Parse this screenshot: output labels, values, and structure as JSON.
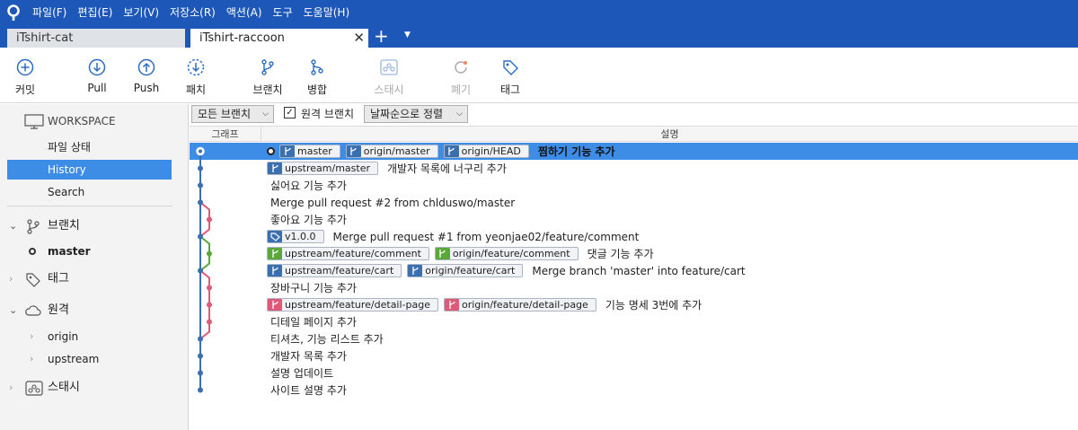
{
  "menubar": {
    "items": [
      "파일(F)",
      "편집(E)",
      "보기(V)",
      "저장소(R)",
      "액션(A)",
      "도구",
      "도움말(H)"
    ]
  },
  "tabs": [
    {
      "label": "iTshirt-cat"
    },
    {
      "label": "iTshirt-raccoon"
    }
  ],
  "toolbar": {
    "commit": "커밋",
    "pull": "Pull",
    "push": "Push",
    "fetch": "패치",
    "branch": "브랜치",
    "merge": "병합",
    "stash": "스태시",
    "discard": "폐기",
    "tag": "태그"
  },
  "sidebar": {
    "workspace": "WORKSPACE",
    "file_status": "파일 상태",
    "history": "History",
    "search": "Search",
    "branches": "브랜치",
    "master": "master",
    "tags": "태그",
    "remotes": "원격",
    "origin": "origin",
    "upstream": "upstream",
    "stashes": "스태시"
  },
  "filter": {
    "branches_dropdown": "모든 브랜치",
    "remote_branches_label": "원격 브랜치",
    "remote_branches_checked": true,
    "sort_dropdown": "날짜순으로 정렬"
  },
  "columns": {
    "graph": "그래프",
    "description": "설명"
  },
  "commits": [
    {
      "current": true,
      "refs": [
        {
          "name": "master",
          "type": "branch",
          "color": "#3a6fb0"
        },
        {
          "name": "origin/master",
          "type": "branch",
          "color": "#3a6fb0"
        },
        {
          "name": "origin/HEAD",
          "type": "branch",
          "color": "#3a6fb0"
        }
      ],
      "message": "찜하기 기능 추가"
    },
    {
      "refs": [
        {
          "name": "upstream/master",
          "type": "branch",
          "color": "#3a6fb0"
        }
      ],
      "message": "개발자 목록에 너구리 추가"
    },
    {
      "refs": [],
      "message": "싫어요 기능 추가"
    },
    {
      "refs": [],
      "message": "Merge pull request #2 from chlduswo/master"
    },
    {
      "refs": [],
      "message": "좋아요 기능 추가"
    },
    {
      "refs": [
        {
          "name": "v1.0.0",
          "type": "tag",
          "color": "#3a6fb0"
        }
      ],
      "message": "Merge pull request #1 from yeonjae02/feature/comment"
    },
    {
      "refs": [
        {
          "name": "upstream/feature/comment",
          "type": "branch",
          "color": "#5aa83a"
        },
        {
          "name": "origin/feature/comment",
          "type": "branch",
          "color": "#5aa83a"
        }
      ],
      "message": "댓글 기능 추가"
    },
    {
      "refs": [
        {
          "name": "upstream/feature/cart",
          "type": "branch",
          "color": "#3a6fb0"
        },
        {
          "name": "origin/feature/cart",
          "type": "branch",
          "color": "#3a6fb0"
        }
      ],
      "message": "Merge branch 'master' into feature/cart"
    },
    {
      "refs": [],
      "message": "장바구니 기능 추가"
    },
    {
      "refs": [
        {
          "name": "upstream/feature/detail-page",
          "type": "branch",
          "color": "#e05a78"
        },
        {
          "name": "origin/feature/detail-page",
          "type": "branch",
          "color": "#e05a78"
        }
      ],
      "message": "기능 명세 3번에 추가"
    },
    {
      "refs": [],
      "message": "디테일 페이지 추가"
    },
    {
      "refs": [],
      "message": "티셔츠, 기능 리스트 추가"
    },
    {
      "refs": [],
      "message": "개발자 목록 추가"
    },
    {
      "refs": [],
      "message": "설명 업데이트"
    },
    {
      "refs": [],
      "message": "사이트 설명 추가"
    }
  ],
  "graph": {
    "lane_colors": [
      "#3a6fb0",
      "#e05a78",
      "#5aa83a"
    ],
    "commit_lanes": [
      0,
      0,
      0,
      0,
      1,
      0,
      2,
      0,
      1,
      1,
      1,
      0,
      0,
      0,
      0
    ]
  },
  "colors": {
    "accent": "#1d57b8",
    "selection": "#3d8de6"
  }
}
